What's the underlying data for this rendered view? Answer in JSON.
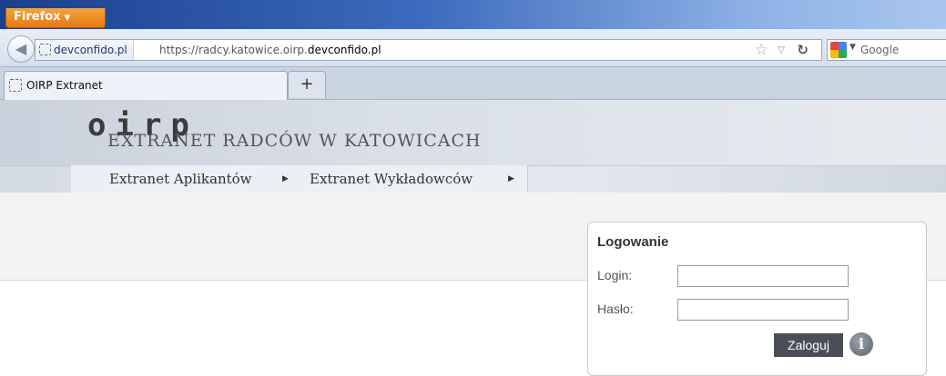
{
  "browser": {
    "menu_button": "Firefox",
    "identity": "devconfido.pl",
    "url_prefix": "https://radcy.katowice.oirp.",
    "url_domain": "devconfido.pl",
    "search_engine": "Google",
    "tab_title": "OIRP Extranet",
    "newtab_label": "+"
  },
  "site": {
    "logo": "oirp",
    "menu": [
      {
        "label": "Extranet Aplikantów"
      },
      {
        "label": "Extranet Wykładowców"
      }
    ],
    "title": "EXTRANET RADCÓW W KATOWICACH"
  },
  "login": {
    "heading": "Logowanie",
    "login_label": "Login:",
    "password_label": "Hasło:",
    "login_value": "",
    "password_value": "",
    "submit_label": "Zaloguj",
    "info_glyph": "i"
  },
  "icons": {
    "back": "back-arrow-icon",
    "bookmark": "star-icon",
    "reload": "reload-icon",
    "info": "info-icon"
  },
  "colors": {
    "firefox_orange": "#e57a10",
    "login_button": "#4a4f57"
  }
}
